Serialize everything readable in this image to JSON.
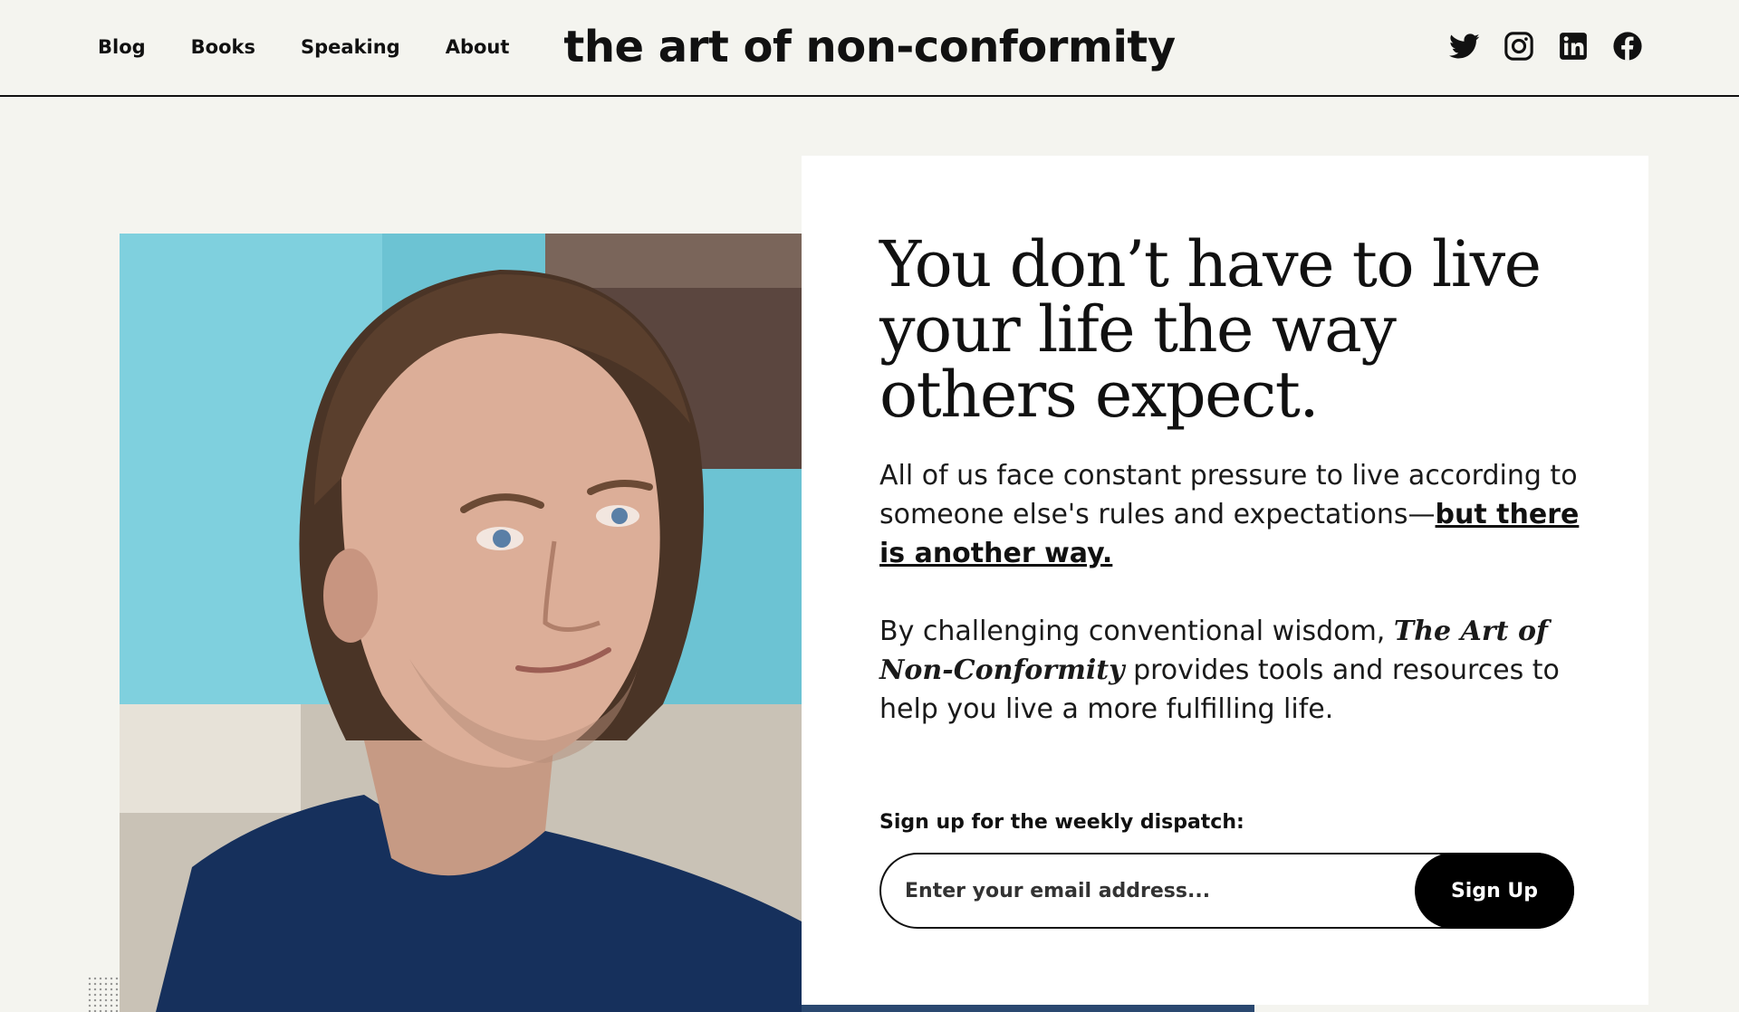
{
  "header": {
    "nav": [
      {
        "label": "Blog"
      },
      {
        "label": "Books"
      },
      {
        "label": "Speaking"
      },
      {
        "label": "About"
      }
    ],
    "site_title": "the art of non-conformity",
    "social": [
      "twitter-icon",
      "instagram-icon",
      "linkedin-icon",
      "facebook-icon"
    ]
  },
  "hero": {
    "headline": "You don’t have to live your life the way others expect.",
    "para1_text": "All of us face constant pressure to live according to someone else's rules and expectations—",
    "para1_link": "but there is another way.",
    "para2_pre": "By challenging conventional wisdom, ",
    "para2_title": "The Art of Non-Conformity",
    "para2_post": " provides tools and resources to help you live a more fulfilling life.",
    "signup_label": "Sign up for the weekly dispatch:",
    "email_placeholder": "Enter your email address...",
    "signup_button": "Sign Up"
  },
  "colors": {
    "background": "#f4f4ef",
    "card": "#ffffff",
    "accent": "#000000"
  }
}
